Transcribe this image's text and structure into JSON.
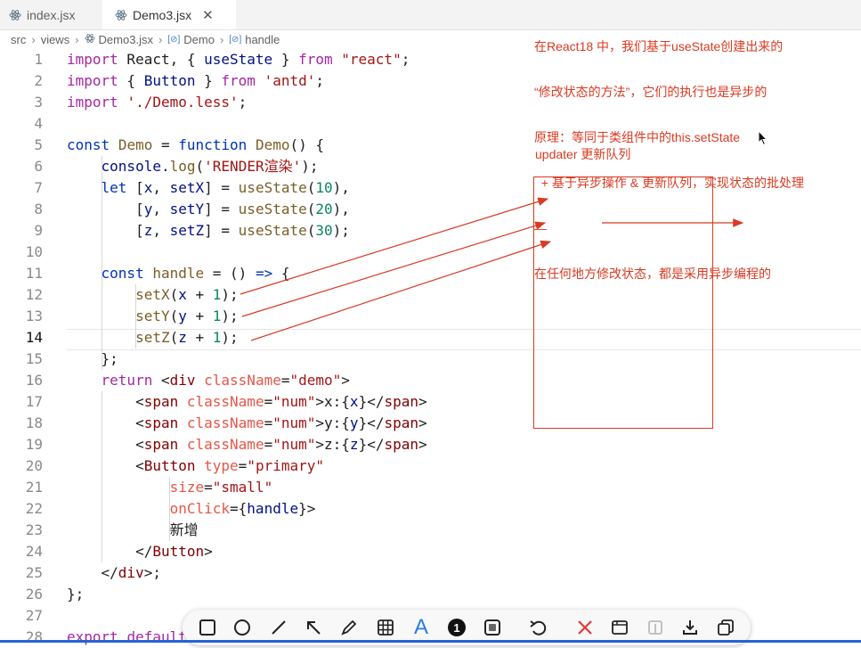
{
  "tabs": [
    {
      "label": "index.jsx",
      "active": false,
      "icon": "react-file-icon"
    },
    {
      "label": "Demo3.jsx",
      "active": true,
      "icon": "react-file-icon",
      "close": "✕"
    }
  ],
  "breadcrumb": [
    "src",
    "views",
    "Demo3.jsx",
    "Demo",
    "handle"
  ],
  "editor": {
    "current_line": 14,
    "line_numbers": [
      "1",
      "2",
      "3",
      "4",
      "5",
      "6",
      "7",
      "8",
      "9",
      "10",
      "11",
      "12",
      "13",
      "14",
      "15",
      "16",
      "17",
      "18",
      "19",
      "20",
      "21",
      "22",
      "23",
      "24",
      "25",
      "26",
      "27",
      "28"
    ],
    "lines": [
      [
        [
          "kw",
          "import"
        ],
        [
          "plain",
          " React, { "
        ],
        [
          "var",
          "useState"
        ],
        [
          "plain",
          " } "
        ],
        [
          "kw",
          "from"
        ],
        [
          "plain",
          " "
        ],
        [
          "str",
          "\"react\""
        ],
        [
          "plain",
          ";"
        ]
      ],
      [
        [
          "kw",
          "import"
        ],
        [
          "plain",
          " { "
        ],
        [
          "var",
          "Button"
        ],
        [
          "plain",
          " } "
        ],
        [
          "kw",
          "from"
        ],
        [
          "plain",
          " "
        ],
        [
          "str",
          "'antd'"
        ],
        [
          "plain",
          ";"
        ]
      ],
      [
        [
          "kw",
          "import"
        ],
        [
          "plain",
          " "
        ],
        [
          "str",
          "'./Demo.less'"
        ],
        [
          "plain",
          ";"
        ]
      ],
      [],
      [
        [
          "kb",
          "const"
        ],
        [
          "plain",
          " "
        ],
        [
          "fn",
          "Demo"
        ],
        [
          "plain",
          " = "
        ],
        [
          "kb",
          "function"
        ],
        [
          "plain",
          " "
        ],
        [
          "fn",
          "Demo"
        ],
        [
          "plain",
          "() {"
        ]
      ],
      [
        [
          "plain",
          "    "
        ],
        [
          "var",
          "console"
        ],
        [
          "plain",
          "."
        ],
        [
          "fn",
          "log"
        ],
        [
          "plain",
          "("
        ],
        [
          "str",
          "'RENDER渲染'"
        ],
        [
          "plain",
          ");"
        ]
      ],
      [
        [
          "plain",
          "    "
        ],
        [
          "kb",
          "let"
        ],
        [
          "plain",
          " ["
        ],
        [
          "var",
          "x"
        ],
        [
          "plain",
          ", "
        ],
        [
          "var",
          "setX"
        ],
        [
          "plain",
          "] = "
        ],
        [
          "fn",
          "useState"
        ],
        [
          "plain",
          "("
        ],
        [
          "num",
          "10"
        ],
        [
          "plain",
          "),"
        ]
      ],
      [
        [
          "plain",
          "        ["
        ],
        [
          "var",
          "y"
        ],
        [
          "plain",
          ", "
        ],
        [
          "var",
          "setY"
        ],
        [
          "plain",
          "] = "
        ],
        [
          "fn",
          "useState"
        ],
        [
          "plain",
          "("
        ],
        [
          "num",
          "20"
        ],
        [
          "plain",
          "),"
        ]
      ],
      [
        [
          "plain",
          "        ["
        ],
        [
          "var",
          "z"
        ],
        [
          "plain",
          ", "
        ],
        [
          "var",
          "setZ"
        ],
        [
          "plain",
          "] = "
        ],
        [
          "fn",
          "useState"
        ],
        [
          "plain",
          "("
        ],
        [
          "num",
          "30"
        ],
        [
          "plain",
          ");"
        ]
      ],
      [],
      [
        [
          "plain",
          "    "
        ],
        [
          "kb",
          "const"
        ],
        [
          "plain",
          " "
        ],
        [
          "fn",
          "handle"
        ],
        [
          "plain",
          " = () "
        ],
        [
          "kb",
          "=>"
        ],
        [
          "plain",
          " {"
        ]
      ],
      [
        [
          "plain",
          "        "
        ],
        [
          "fn",
          "setX"
        ],
        [
          "plain",
          "("
        ],
        [
          "var",
          "x"
        ],
        [
          "plain",
          " + "
        ],
        [
          "num",
          "1"
        ],
        [
          "plain",
          ");"
        ]
      ],
      [
        [
          "plain",
          "        "
        ],
        [
          "fn",
          "setY"
        ],
        [
          "plain",
          "("
        ],
        [
          "var",
          "y"
        ],
        [
          "plain",
          " + "
        ],
        [
          "num",
          "1"
        ],
        [
          "plain",
          ");"
        ]
      ],
      [
        [
          "plain",
          "        "
        ],
        [
          "fn",
          "setZ"
        ],
        [
          "plain",
          "("
        ],
        [
          "var",
          "z"
        ],
        [
          "plain",
          " + "
        ],
        [
          "num",
          "1"
        ],
        [
          "plain",
          ");"
        ]
      ],
      [
        [
          "plain",
          "    };"
        ]
      ],
      [
        [
          "plain",
          "    "
        ],
        [
          "kw",
          "return"
        ],
        [
          "plain",
          " <"
        ],
        [
          "tag",
          "div"
        ],
        [
          "plain",
          " "
        ],
        [
          "attr",
          "className"
        ],
        [
          "plain",
          "="
        ],
        [
          "str",
          "\"demo\""
        ],
        [
          "plain",
          ">"
        ]
      ],
      [
        [
          "plain",
          "        <"
        ],
        [
          "tag",
          "span"
        ],
        [
          "plain",
          " "
        ],
        [
          "attr",
          "className"
        ],
        [
          "plain",
          "="
        ],
        [
          "str",
          "\"num\""
        ],
        [
          "plain",
          ">x:{"
        ],
        [
          "var",
          "x"
        ],
        [
          "plain",
          "}</"
        ],
        [
          "tag",
          "span"
        ],
        [
          "plain",
          ">"
        ]
      ],
      [
        [
          "plain",
          "        <"
        ],
        [
          "tag",
          "span"
        ],
        [
          "plain",
          " "
        ],
        [
          "attr",
          "className"
        ],
        [
          "plain",
          "="
        ],
        [
          "str",
          "\"num\""
        ],
        [
          "plain",
          ">y:{"
        ],
        [
          "var",
          "y"
        ],
        [
          "plain",
          "}</"
        ],
        [
          "tag",
          "span"
        ],
        [
          "plain",
          ">"
        ]
      ],
      [
        [
          "plain",
          "        <"
        ],
        [
          "tag",
          "span"
        ],
        [
          "plain",
          " "
        ],
        [
          "attr",
          "className"
        ],
        [
          "plain",
          "="
        ],
        [
          "str",
          "\"num\""
        ],
        [
          "plain",
          ">z:{"
        ],
        [
          "var",
          "z"
        ],
        [
          "plain",
          "}</"
        ],
        [
          "tag",
          "span"
        ],
        [
          "plain",
          ">"
        ]
      ],
      [
        [
          "plain",
          "        <"
        ],
        [
          "tag",
          "Button"
        ],
        [
          "plain",
          " "
        ],
        [
          "attr",
          "type"
        ],
        [
          "plain",
          "="
        ],
        [
          "str",
          "\"primary\""
        ]
      ],
      [
        [
          "plain",
          "            "
        ],
        [
          "attr",
          "size"
        ],
        [
          "plain",
          "="
        ],
        [
          "str",
          "\"small\""
        ]
      ],
      [
        [
          "plain",
          "            "
        ],
        [
          "attr",
          "onClick"
        ],
        [
          "plain",
          "={"
        ],
        [
          "var",
          "handle"
        ],
        [
          "plain",
          "}>"
        ]
      ],
      [
        [
          "plain",
          "            新增"
        ]
      ],
      [
        [
          "plain",
          "        </"
        ],
        [
          "tag",
          "Button"
        ],
        [
          "plain",
          ">"
        ]
      ],
      [
        [
          "plain",
          "    </"
        ],
        [
          "tag",
          "div"
        ],
        [
          "plain",
          ">;"
        ]
      ],
      [
        [
          "plain",
          "};"
        ]
      ],
      [],
      [
        [
          "kw",
          "export"
        ],
        [
          "plain",
          " "
        ],
        [
          "kw",
          "default"
        ]
      ]
    ]
  },
  "annotations": {
    "note_lines": [
      "在React18 中，我们基于useState创建出来的",
      "“修改状态的方法”，它们的执行也是异步的",
      "原理：等同于类组件中的this.setState",
      "  + 基于异步操作 & 更新队列，实现状态的批处理",
      "—",
      "在任何地方修改状态，都是采用异步编程的"
    ],
    "queue_label": "updater 更新队列",
    "accent_color": "#d93a21"
  },
  "toolbar": {
    "tools": [
      "rectangle-icon",
      "ellipse-icon",
      "line-icon",
      "arrow-icon",
      "pen-icon",
      "mosaic-icon",
      "text-icon",
      "step-number-icon",
      "blur-icon",
      "undo-icon",
      "cancel-icon",
      "save-icon",
      "pin-icon",
      "download-icon",
      "copy-icon"
    ],
    "text_tool_glyph": "A",
    "step_number_glyph": "1",
    "cancel_color": "#e53935",
    "text_color": "#2a7de1"
  }
}
